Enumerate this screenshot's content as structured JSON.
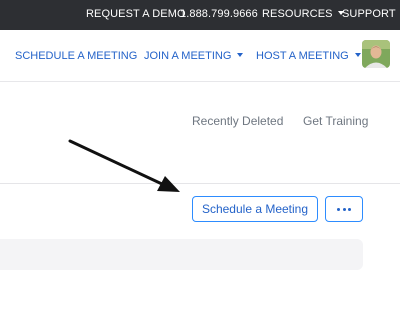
{
  "top_bar": {
    "request_demo": "REQUEST A DEMO",
    "phone": "1.888.799.9666",
    "resources": "RESOURCES",
    "support": "SUPPORT"
  },
  "nav": {
    "schedule": "SCHEDULE A MEETING",
    "join": "JOIN A MEETING",
    "host": "HOST A MEETING"
  },
  "links": {
    "recently_deleted": "Recently Deleted",
    "get_training": "Get Training"
  },
  "actions": {
    "schedule_button": "Schedule a Meeting",
    "more_icon": "more-horizontal-icon"
  },
  "colors": {
    "top_bar_bg": "#2d2f33",
    "accent_blue": "#2d8cff",
    "link_blue": "#2463c9",
    "muted_gray": "#6e7680"
  }
}
